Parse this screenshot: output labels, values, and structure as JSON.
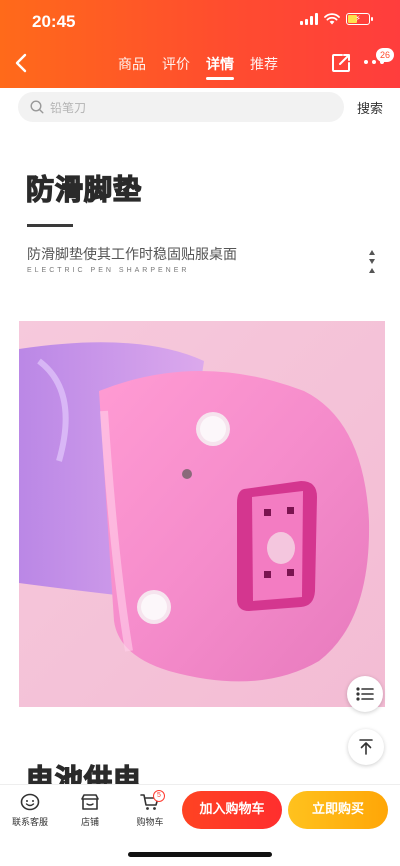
{
  "status": {
    "time": "20:45"
  },
  "nav": {
    "tabs": [
      {
        "label": "商品",
        "active": false
      },
      {
        "label": "评价",
        "active": false
      },
      {
        "label": "详情",
        "active": true
      },
      {
        "label": "推荐",
        "active": false
      }
    ],
    "more_badge": "26"
  },
  "search": {
    "placeholder": "铅笔刀",
    "button_label": "搜索"
  },
  "content": {
    "section_title": "防滑脚垫",
    "subtitle": "防滑脚垫使其工作时稳固贴服桌面",
    "subtitle_en": "ELECTRIC PEN SHARPENER",
    "next_section_title": "电池供电"
  },
  "bottom": {
    "service_label": "联系客服",
    "shop_label": "店铺",
    "cart_label": "购物车",
    "cart_count": "5",
    "add_cart_label": "加入购物车",
    "buy_now_label": "立即购买"
  },
  "colors": {
    "header_start": "#ff6a1a",
    "header_end": "#ff3d3d",
    "add_cart": "#ff3b2a",
    "buy_now": "#ffb413"
  }
}
